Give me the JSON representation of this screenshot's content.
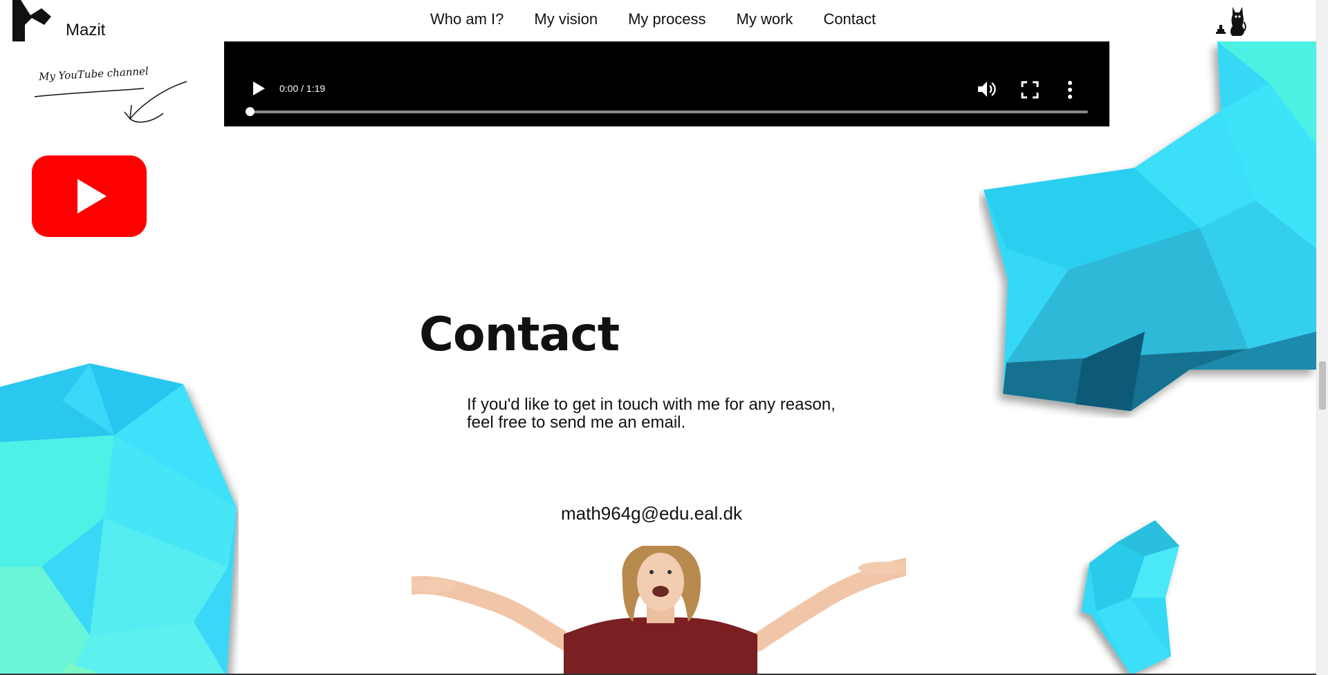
{
  "header": {
    "brand": "Mazit",
    "nav": [
      "Who am I?",
      "My vision",
      "My process",
      "My work",
      "Contact"
    ]
  },
  "sidebar": {
    "youtube_note": "My YouTube channel"
  },
  "video": {
    "time": "0:00 / 1:19",
    "progress": 0
  },
  "contact": {
    "title": "Contact",
    "text": "If you'd like to get in touch with me for any reason, feel free to send me an email.",
    "email": "math964g@edu.eal.dk"
  },
  "colors": {
    "accent_cyan": "#3ae0fb",
    "youtube_red": "#ff0000",
    "shirt": "#7a1f22"
  },
  "icons": [
    "logo-m-icon",
    "cat-icon",
    "arrow-scribble-icon",
    "youtube-icon",
    "play-icon",
    "volume-icon",
    "fullscreen-icon",
    "more-options-icon"
  ]
}
